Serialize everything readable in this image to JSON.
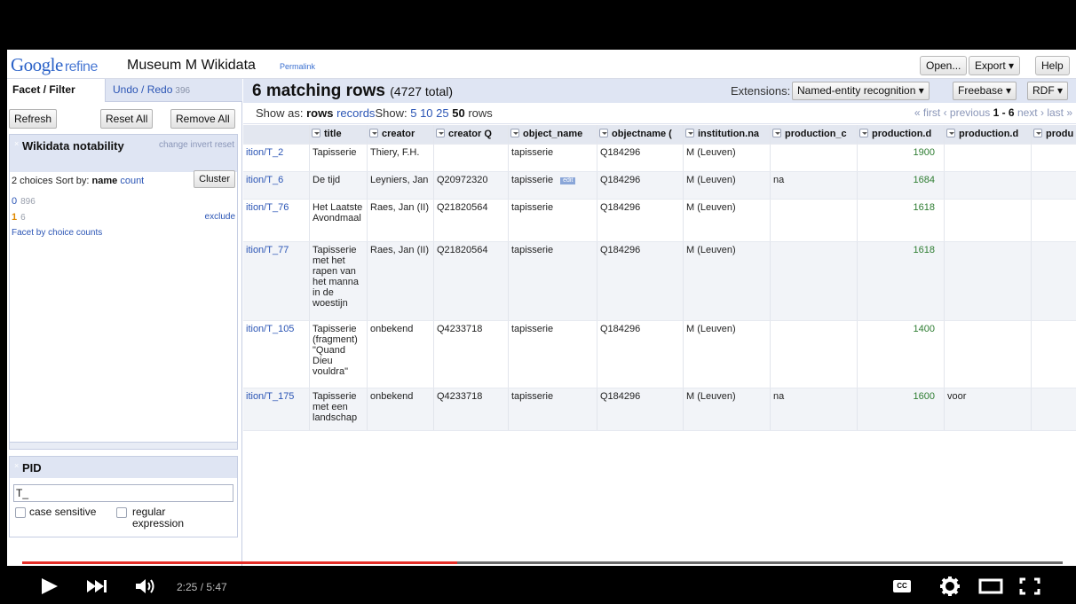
{
  "app": {
    "logo_google": "Google",
    "logo_refine": "refine",
    "project_name": "Museum M Wikidata",
    "permalink": "Permalink",
    "btn_open": "Open...",
    "btn_export": "Export ▾",
    "btn_help": "Help"
  },
  "left": {
    "tab_facet": "Facet / Filter",
    "tab_undo": "Undo / Redo",
    "tab_undo_count": "396",
    "btn_refresh": "Refresh",
    "btn_reset_all": "Reset All",
    "btn_remove_all": "Remove All",
    "facet1": {
      "close": "×",
      "title": "Wikidata notability",
      "links": "change invert reset",
      "choices_label": "2 choices",
      "sort_by": "Sort by:",
      "sort_name": "name",
      "sort_count": "count",
      "btn_cluster": "Cluster",
      "choices": [
        {
          "value": "0",
          "count": "896"
        },
        {
          "value": "1",
          "count": "6"
        }
      ],
      "exclude": "exclude",
      "facet_by_counts": "Facet by choice counts"
    },
    "facet2": {
      "close": "×",
      "title": "PID",
      "input_value": "T_",
      "case_label": "case sensitive",
      "regex_label": "regular expression"
    }
  },
  "main": {
    "summary_count": "6 matching rows",
    "summary_total": "(4727 total)",
    "extensions_label": "Extensions:",
    "btn_ner": "Named-entity recognition ▾",
    "btn_freebase": "Freebase ▾",
    "btn_rdf": "RDF ▾",
    "show_as": "Show as:",
    "rows_label": "rows",
    "records_label": "records",
    "show_label": "Show:",
    "page_sizes": [
      "5",
      "10",
      "25"
    ],
    "page_size_selected": "50",
    "rows_word": "rows",
    "pager_first": "« first",
    "pager_prev": "‹ previous",
    "pager_range": "1 - 6",
    "pager_next": "next ›",
    "pager_last": "last »"
  },
  "table": {
    "columns": [
      "",
      "title",
      "creator",
      "creator Q",
      "object_name",
      "objectname (",
      "institution.na",
      "production_c",
      "production.d",
      "production.d",
      "produ"
    ],
    "rows": [
      [
        "ition/T_2",
        "Tapisserie",
        "Thiery, F.H.",
        "",
        "tapisserie",
        "Q184296",
        "M (Leuven)",
        "",
        "1900",
        "",
        ""
      ],
      [
        "ition/T_6",
        "De tijd",
        "Leyniers, Jan",
        "Q20972320",
        "tapisserie",
        "Q184296",
        "M (Leuven)",
        "na",
        "1684",
        "",
        ""
      ],
      [
        "ition/T_76",
        "Het Laatste Avondmaal",
        "Raes, Jan (II)",
        "Q21820564",
        "tapisserie",
        "Q184296",
        "M (Leuven)",
        "",
        "1618",
        "",
        ""
      ],
      [
        "ition/T_77",
        "Tapisserie met het rapen van het manna in de woestijn",
        "Raes, Jan (II)",
        "Q21820564",
        "tapisserie",
        "Q184296",
        "M (Leuven)",
        "",
        "1618",
        "",
        ""
      ],
      [
        "ition/T_105",
        "Tapisserie (fragment) \"Quand Dieu vouldra\"",
        "onbekend",
        "Q4233718",
        "tapisserie",
        "Q184296",
        "M (Leuven)",
        "",
        "1400",
        "",
        ""
      ],
      [
        "ition/T_175",
        "Tapisserie met een landschap",
        "onbekend",
        "Q4233718",
        "tapisserie",
        "Q184296",
        "M (Leuven)",
        "na",
        "1600",
        "voor",
        ""
      ]
    ],
    "edit_tag": "edit"
  },
  "video": {
    "time": "2:25 / 5:47",
    "progress": 0.418,
    "cc_label": "CC",
    "accent": "#e52d27"
  }
}
